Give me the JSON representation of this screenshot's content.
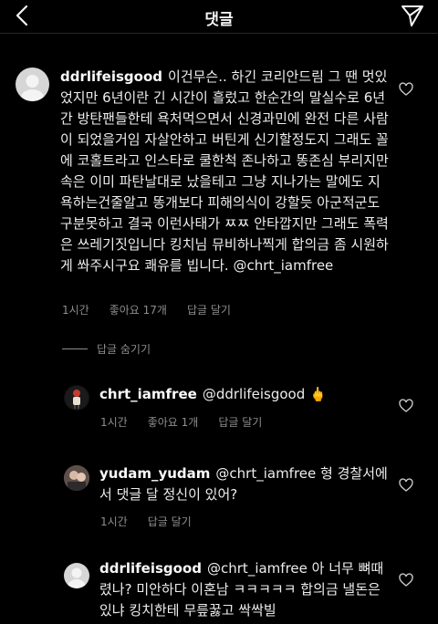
{
  "header": {
    "title": "댓글"
  },
  "comments": [
    {
      "username": "ddrlifeisgood",
      "text": "이건무슨.. 하긴 코리안드림 그 땐 멋있었지만 6년이란 긴 시간이 흘렀고 한순간의 말실수로 6년간 방탄팬들한테 욕처먹으면서 신경과민에 완전 다른 사람이 되었을거임 자살안하고 버틴게 신기할정도지 그래도 꼴에 코홀트라고 인스타로 쿨한척 존나하고 똥존심 부리지만 속은 이미 파탄날대로 났을테고 그냥 지나가는 말에도 지욕하는건줄알고 똥개보다 피해의식이 강할듯 아군적군도 구분못하고 결국 이런사태가 ㅉㅉ 안타깝지만 그래도 폭력은 쓰레기짓입니다 킹치님 뮤비하나찍게 합의금 좀 시원하게 쏴주시구요 쾌유를 빕니다. @chrt_iamfree",
      "time": "1시간",
      "likes": "좋아요 17개",
      "reply": "답글 달기"
    },
    {
      "username": "chrt_iamfree",
      "text": "@ddrlifeisgood 🖕",
      "time": "1시간",
      "likes": "좋아요 1개",
      "reply": "답글 달기"
    },
    {
      "username": "yudam_yudam",
      "text": "@chrt_iamfree 형 경찰서에서 댓글 달 정신이 있어?",
      "time": "1시간",
      "reply": "답글 달기"
    },
    {
      "username": "ddrlifeisgood",
      "text": "@chrt_iamfree 아 너무 뼈때렸나? 미안하다 이혼남 ㅋㅋㅋㅋㅋ 합의금 낼돈은있냐 킹치한테 무릎꿇고 싹싹빌"
    }
  ],
  "hide_replies": "답글 숨기기",
  "icons": [
    "back-arrow-icon",
    "send-icon",
    "heart-icon"
  ]
}
